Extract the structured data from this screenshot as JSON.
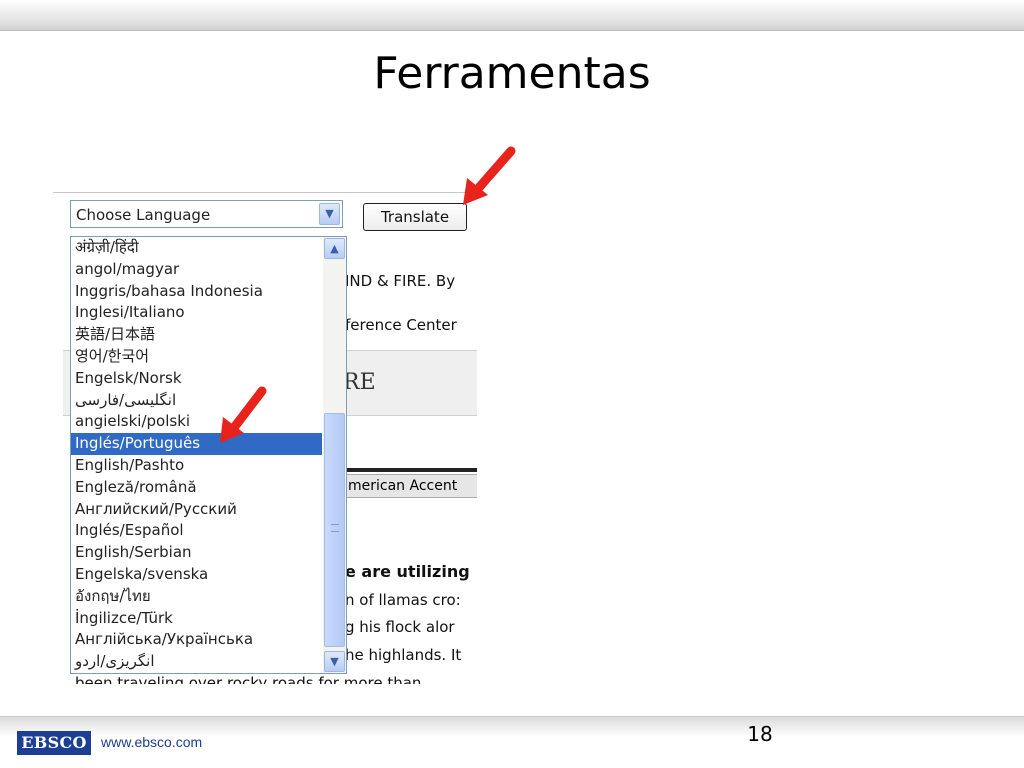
{
  "slide": {
    "title": "Ferramentas",
    "page_number": "18"
  },
  "footer": {
    "logo_text": "EBSCO",
    "url": "www.ebsco.com"
  },
  "translator": {
    "select_value": "Choose Language",
    "button_label": "Translate",
    "selected_option": "Inglés/Português",
    "options": [
      "अंग्रेज़ी/हिंदी",
      "angol/magyar",
      "Inggris/bahasa Indonesia",
      "Inglesi/Italiano",
      "英語/日本語",
      "영어/한국어",
      "Engelsk/Norsk",
      "انگلیسی/فارسی",
      "angielski/polski",
      "Inglés/Português",
      "English/Pashto",
      "Engleză/română",
      "Английский/Русский",
      "Inglés/Español",
      "English/Serbian",
      "Engelska/svenska",
      "อังกฤษ/ไทย",
      "İngilizce/Türk",
      "Англійська/Українська",
      "انگریزی/اردو"
    ]
  },
  "background_page": {
    "line1": "IND & FIRE. By",
    "line2": "ference Center",
    "banner": "RE",
    "accent_tab": "merican Accent",
    "bold_line": "e are utilizing",
    "body": [
      "n of llamas cro:",
      "g his flock alor",
      "he highlands. It",
      "been traveling over rocky roads for more than"
    ]
  },
  "colors": {
    "selection": "#316ac5",
    "arrow": "#e8231c",
    "logo_bg": "#1c3f94"
  }
}
